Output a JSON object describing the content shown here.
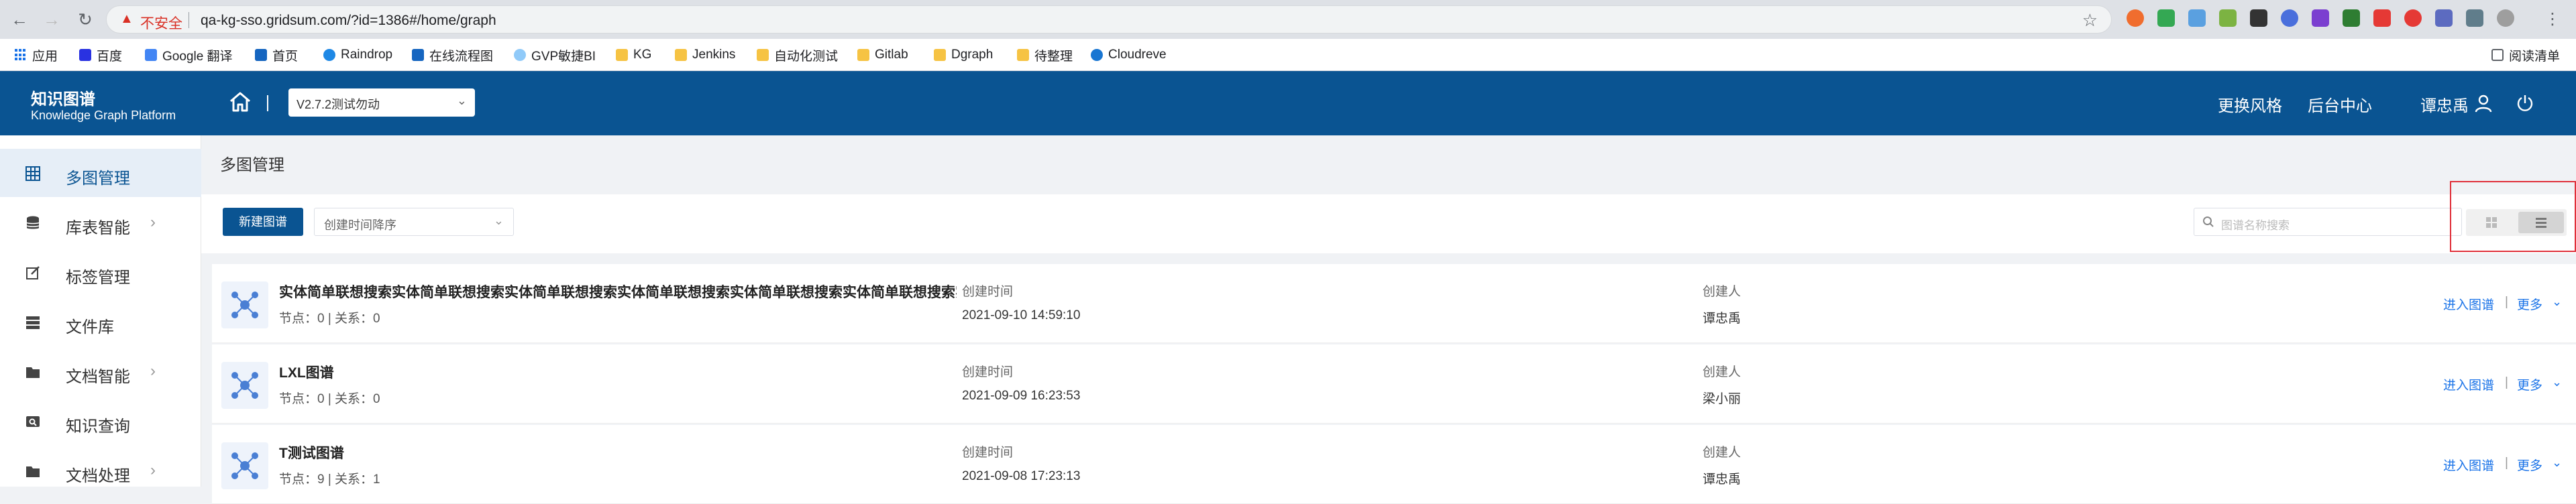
{
  "browser": {
    "insecure_label": "不安全",
    "url": "qa-kg-sso.gridsum.com/?id=1386#/home/graph",
    "bookmarks": [
      "应用",
      "百度",
      "Google 翻译",
      "首页",
      "Raindrop",
      "在线流程图",
      "GVP敏捷BI",
      "KG",
      "Jenkins",
      "自动化测试",
      "Gitlab",
      "Dgraph",
      "待整理",
      "Cloudreve"
    ],
    "reading_list": "阅读清单"
  },
  "header": {
    "brand_title": "知识图谱",
    "brand_subtitle": "Knowledge Graph Platform",
    "version": "V2.7.2测试勿动",
    "theme_link": "更换风格",
    "admin_link": "后台中心",
    "user_name": "谭忠禹"
  },
  "sidebar": {
    "items": [
      {
        "label": "多图管理",
        "icon": "grid-icon",
        "active": true
      },
      {
        "label": "库表智能",
        "icon": "database-icon"
      },
      {
        "label": "标签管理",
        "icon": "edit-icon"
      },
      {
        "label": "文件库",
        "icon": "server-icon"
      },
      {
        "label": "文档智能",
        "icon": "folder-icon"
      },
      {
        "label": "知识查询",
        "icon": "search-doc-icon"
      },
      {
        "label": "文档处理",
        "icon": "doc-process-icon"
      }
    ]
  },
  "main": {
    "title": "多图管理",
    "new_button": "新建图谱",
    "sort_value": "创建时间降序",
    "search_placeholder": "图谱名称搜索",
    "created_time_label": "创建时间",
    "creator_label": "创建人",
    "enter_link": "进入图谱",
    "more_link": "更多",
    "separator": "|",
    "graphs": [
      {
        "name": "实体简单联想搜索实体简单联想搜索实体简单联想搜索实体简单联想搜索实体简单联想搜索实体简单联想搜索实体简单联想...",
        "stats": "节点：0 | 关系：0",
        "created": "2021-09-10 14:59:10",
        "creator": "谭忠禹"
      },
      {
        "name": "LXL图谱",
        "stats": "节点：0 | 关系：0",
        "created": "2021-09-09 16:23:53",
        "creator": "梁小丽"
      },
      {
        "name": "T测试图谱",
        "stats": "节点：9 | 关系：1",
        "created": "2021-09-08 17:23:13",
        "creator": "谭忠禹"
      }
    ]
  },
  "colors": {
    "primary": "#0a5492",
    "link": "#1a73e8",
    "highlight_border": "#e0303a"
  }
}
